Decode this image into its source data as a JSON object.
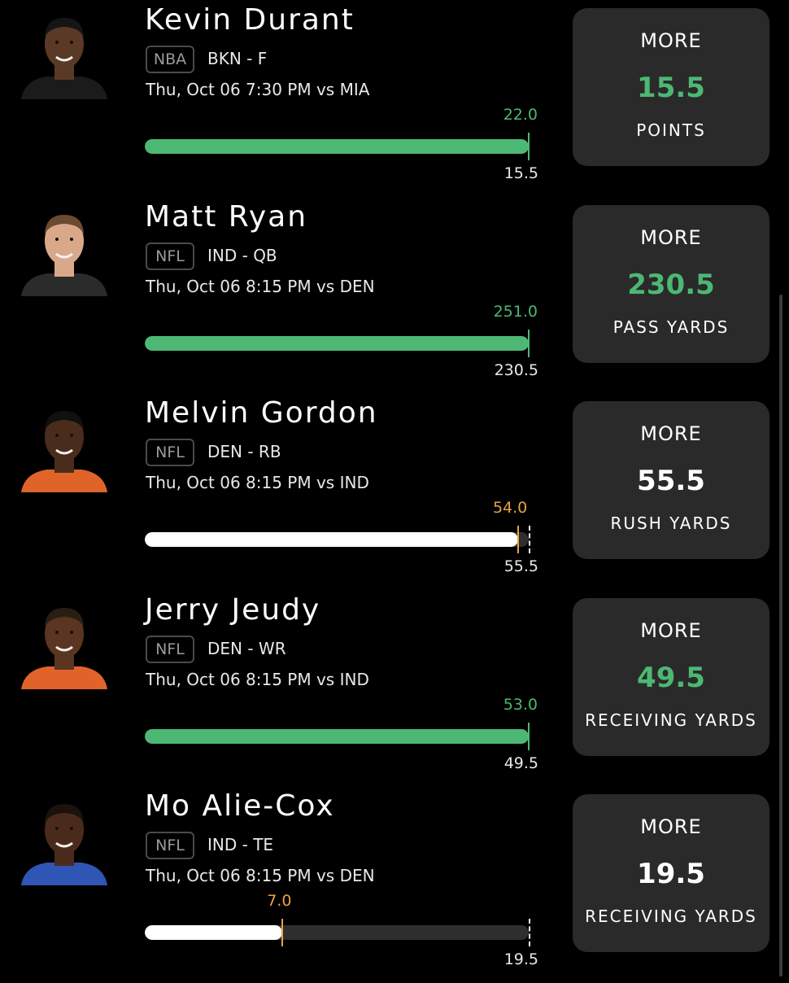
{
  "colors": {
    "background": "#000000",
    "card": "#2a2a2a",
    "green": "#4cb873",
    "orange": "#e7a245",
    "white_bar": "#ffffff",
    "track": "#2e2e2e"
  },
  "players": [
    {
      "name": "Kevin Durant",
      "league": "NBA",
      "team_pos": "BKN - F",
      "game": "Thu, Oct 06 7:30 PM  vs MIA",
      "actual": "22.0",
      "actual_value": 22.0,
      "line": "15.5",
      "line_value": 15.5,
      "status": "hit",
      "pick": "MORE",
      "pick_value": "15.5",
      "stat": "POINTS",
      "jersey_color": "#1b1b1b",
      "skin": "#5a3a26",
      "hair": "#151515"
    },
    {
      "name": "Matt Ryan",
      "league": "NFL",
      "team_pos": "IND - QB",
      "game": "Thu, Oct 06 8:15 PM  vs DEN",
      "actual": "251.0",
      "actual_value": 251.0,
      "line": "230.5",
      "line_value": 230.5,
      "status": "hit",
      "pick": "MORE",
      "pick_value": "230.5",
      "stat": "PASS YARDS",
      "jersey_color": "#2b2b2b",
      "skin": "#d9a88a",
      "hair": "#6b4a32"
    },
    {
      "name": "Melvin Gordon",
      "league": "NFL",
      "team_pos": "DEN - RB",
      "game": "Thu, Oct 06 8:15 PM  vs IND",
      "actual": "54.0",
      "actual_value": 54.0,
      "line": "55.5",
      "line_value": 55.5,
      "status": "miss",
      "pick": "MORE",
      "pick_value": "55.5",
      "stat": "RUSH YARDS",
      "jersey_color": "#e0642a",
      "skin": "#4a2c1d",
      "hair": "#101010"
    },
    {
      "name": "Jerry Jeudy",
      "league": "NFL",
      "team_pos": "DEN - WR",
      "game": "Thu, Oct 06 8:15 PM  vs IND",
      "actual": "53.0",
      "actual_value": 53.0,
      "line": "49.5",
      "line_value": 49.5,
      "status": "hit",
      "pick": "MORE",
      "pick_value": "49.5",
      "stat": "RECEIVING YARDS",
      "jersey_color": "#e0642a",
      "skin": "#5a3522",
      "hair": "#2a1d12"
    },
    {
      "name": "Mo Alie-Cox",
      "league": "NFL",
      "team_pos": "IND - TE",
      "game": "Thu, Oct 06 8:15 PM  vs DEN",
      "actual": "7.0",
      "actual_value": 7.0,
      "line": "19.5",
      "line_value": 19.5,
      "status": "miss",
      "pick": "MORE",
      "pick_value": "19.5",
      "stat": "RECEIVING YARDS",
      "jersey_color": "#2f55b5",
      "skin": "#4a2b1b",
      "hair": "#1a120c"
    }
  ]
}
